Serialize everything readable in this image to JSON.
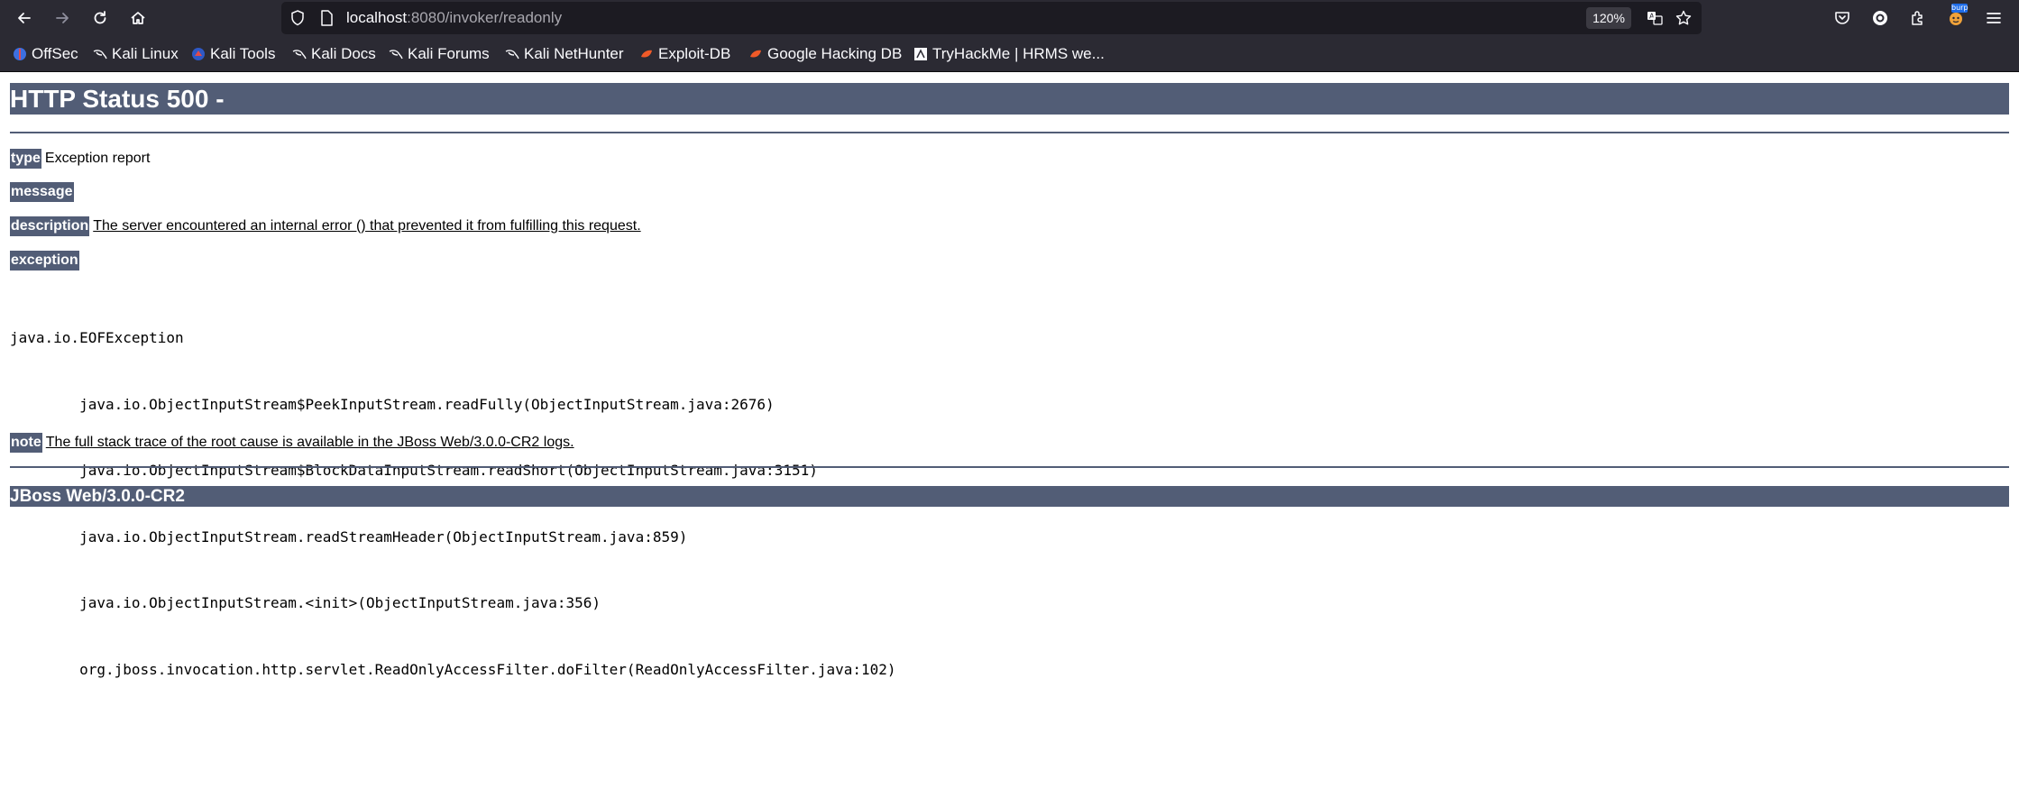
{
  "browser": {
    "url_host": "localhost",
    "url_rest": ":8080/invoker/readonly",
    "zoom": "120%",
    "nav": {
      "back_icon": "arrow-left-icon",
      "forward_icon": "arrow-right-icon",
      "reload_icon": "reload-icon",
      "home_icon": "home-icon"
    },
    "url_icons": [
      "shield-icon",
      "page-icon",
      "translate-icon",
      "star-icon"
    ],
    "right_icons": [
      "pocket-icon",
      "account-icon",
      "extensions-icon",
      "burp-icon",
      "menu-icon"
    ],
    "burp_badge": "burp"
  },
  "bookmarks": [
    {
      "label": "OffSec",
      "icon": "offsec-icon"
    },
    {
      "label": "Kali Linux",
      "icon": "kali-dragon-icon"
    },
    {
      "label": "Kali Tools",
      "icon": "kali-tools-icon"
    },
    {
      "label": "Kali Docs",
      "icon": "kali-dragon-icon"
    },
    {
      "label": "Kali Forums",
      "icon": "kali-dragon-icon"
    },
    {
      "label": "Kali NetHunter",
      "icon": "kali-dragon-icon"
    },
    {
      "label": "Exploit-DB",
      "icon": "exploitdb-icon"
    },
    {
      "label": "Google Hacking DB",
      "icon": "exploitdb-icon"
    },
    {
      "label": "TryHackMe | HRMS we...",
      "icon": "tryhackme-icon"
    }
  ],
  "page": {
    "title": "HTTP Status 500 -",
    "type_label": "type",
    "type_value": "Exception report",
    "message_label": "message",
    "description_label": "description",
    "description_value": "The server encountered an internal error () that prevented it from fulfilling this request.",
    "exception_label": "exception",
    "stack_lines": [
      "java.io.EOFException",
      "\tjava.io.ObjectInputStream$PeekInputStream.readFully(ObjectInputStream.java:2676)",
      "\tjava.io.ObjectInputStream$BlockDataInputStream.readShort(ObjectInputStream.java:3151)",
      "\tjava.io.ObjectInputStream.readStreamHeader(ObjectInputStream.java:859)",
      "\tjava.io.ObjectInputStream.<init>(ObjectInputStream.java:356)",
      "\torg.jboss.invocation.http.servlet.ReadOnlyAccessFilter.doFilter(ReadOnlyAccessFilter.java:102)"
    ],
    "note_label": "note",
    "note_value": "The full stack trace of the root cause is available in the JBoss Web/3.0.0-CR2 logs.",
    "footer": "JBoss Web/3.0.0-CR2"
  },
  "colors": {
    "chrome_bg": "#2b2a33",
    "urlbar_bg": "#1c1b22",
    "jboss_header": "#525d76"
  }
}
